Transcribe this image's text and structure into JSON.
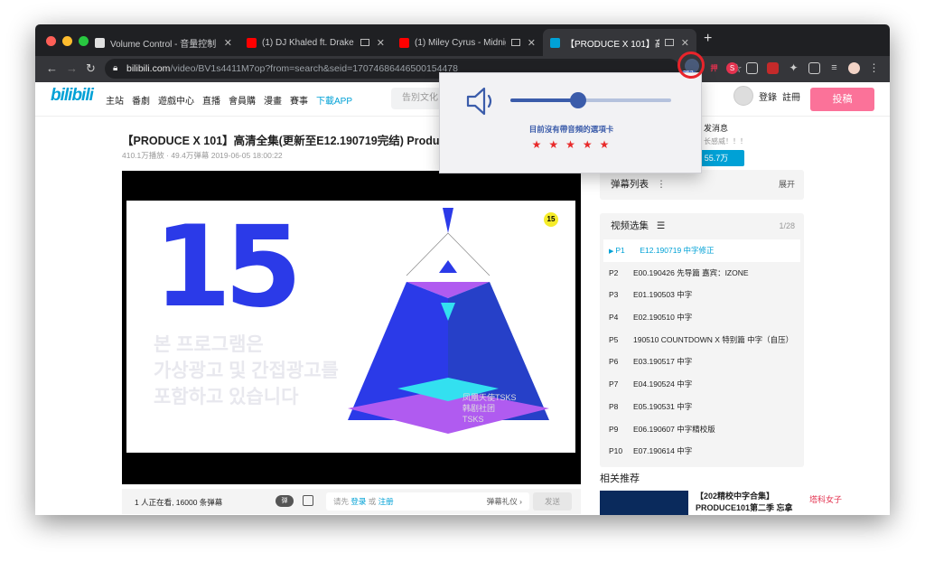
{
  "tabs": [
    {
      "title": "Volume Control - 音量控制 - Ch",
      "fav_color": "#e0e0e0"
    },
    {
      "title": "(1) DJ Khaled ft. Drake - P",
      "fav_color": "#ff0000"
    },
    {
      "title": "(1) Miley Cyrus - Midnight",
      "fav_color": "#ff0000"
    },
    {
      "title": "【PRODUCE X 101】高清全",
      "fav_color": "#00a1d6"
    }
  ],
  "url": {
    "host": "bilibili.com",
    "path": "/video/BV1s4411M7op?from=search&seid=17074686446500154478"
  },
  "extension_badge": "253",
  "site": {
    "logo": "bilibili",
    "menu": [
      "主站",
      "番劇",
      "遊戲中心",
      "直播",
      "會員購",
      "漫畫",
      "賽事",
      "下載APP"
    ],
    "search_placeholder": "告別文化",
    "login": "登錄",
    "register": "註冊",
    "upload": "投稿"
  },
  "video": {
    "title": "【PRODUCE X 101】高清全集(更新至E12.190719完结) Produce",
    "meta": "410.1万播放 · 49.4万弹幕    2019-06-05 18:00:22",
    "korean_lines": [
      "본 프로그램은",
      "가상광고 및 간접광고를",
      "포함하고 있습니다"
    ],
    "big_number": "15",
    "badge": "15",
    "watermark": [
      "凤凰天使TSKS",
      "韩剧社团",
      "TSKS"
    ]
  },
  "controls": {
    "viewers": "1 人正在看,  16000 条弹幕",
    "danmaku_toggle": "弹",
    "login_prompt": "请先",
    "login_link": "登录",
    "or": "或",
    "register_link": "注册",
    "etiquette": "弹幕礼仪 ›",
    "send": "发送"
  },
  "sidebar": {
    "upcard_msg": "发消息",
    "upcard_sub": "长感威！！！",
    "follow_count": "55.7万",
    "danmaku_list": "弹幕列表",
    "expand": "展开",
    "playlist_title": "视频选集",
    "playlist_count": "1/28",
    "items": [
      {
        "n": "P1",
        "t": "E12.190719 中字修正"
      },
      {
        "n": "P2",
        "t": "E00.190426 先导篇 嘉宾：IZONE"
      },
      {
        "n": "P3",
        "t": "E01.190503 中字"
      },
      {
        "n": "P4",
        "t": "E02.190510 中字"
      },
      {
        "n": "P5",
        "t": "190510 COUNTDOWN X 特别篇 中字（自压）"
      },
      {
        "n": "P6",
        "t": "E03.190517 中字"
      },
      {
        "n": "P7",
        "t": "E04.190524 中字"
      },
      {
        "n": "P8",
        "t": "E05.190531 中字"
      },
      {
        "n": "P9",
        "t": "E06.190607 中字精校版"
      },
      {
        "n": "P10",
        "t": "E07.190614 中字"
      }
    ],
    "related": "相关推荐",
    "related_title": "【202精校中字合集】PRODUCE101第二季 忘拿碗...",
    "related_tag": "塔科女子"
  },
  "popup": {
    "volume_percent": 42,
    "message": "目前沒有帶音頻的選項卡",
    "stars": "★★★★★"
  },
  "colors": {
    "accent": "#00a1d6",
    "pink": "#fb7299",
    "popup_blue": "#3b5caa",
    "highlight": "#e8242b"
  }
}
